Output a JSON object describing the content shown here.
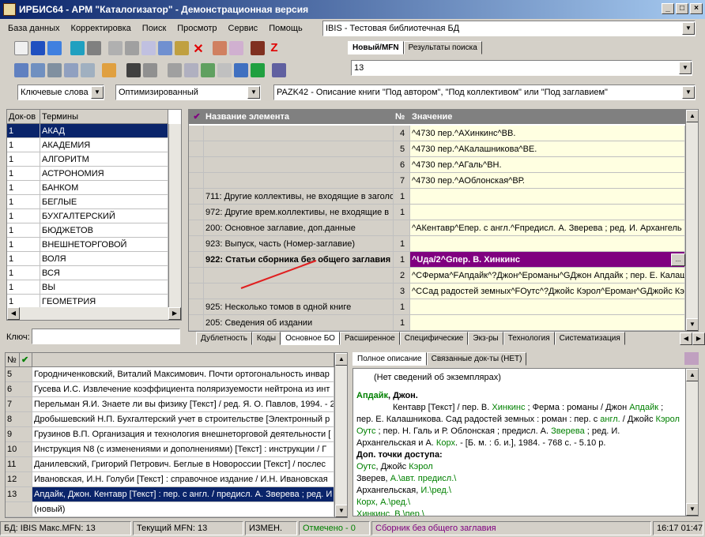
{
  "window": {
    "title": "ИРБИС64 - АРМ \"Каталогизатор\" - Демонстрационная версия"
  },
  "menu": [
    "База данных",
    "Корректировка",
    "Поиск",
    "Просмотр",
    "Сервис",
    "Помощь"
  ],
  "db_select": "IBIS - Тестовая библиотечная БД",
  "mfn_tabs": [
    "Новый/MFN",
    "Результаты поиска"
  ],
  "mfn_value": "13",
  "search_mode": "Ключевые слова",
  "search_opt": "Оптимизированный",
  "worksheet": "PAZK42 - Описание книги \"Под автором\", \"Под коллективом\" или \"Под заглавием\"",
  "terms": {
    "col_docs": "Док-ов",
    "col_terms": "Термины",
    "rows": [
      [
        "1",
        "АКАД"
      ],
      [
        "1",
        "АКАДЕМИЯ"
      ],
      [
        "1",
        "АЛГОРИТМ"
      ],
      [
        "1",
        "АСТРОНОМИЯ"
      ],
      [
        "1",
        "БАНКОМ"
      ],
      [
        "1",
        "БЕГЛЫЕ"
      ],
      [
        "1",
        "БУХГАЛТЕРСКИЙ"
      ],
      [
        "1",
        "БЮДЖЕТОВ"
      ],
      [
        "1",
        "ВНЕШНЕТОРГОВОЙ"
      ],
      [
        "1",
        "ВОЛЯ"
      ],
      [
        "1",
        "ВСЯ"
      ],
      [
        "1",
        "ВЫ"
      ],
      [
        "1",
        "ГЕОМЕТРИЯ"
      ]
    ],
    "key_label": "Ключ:"
  },
  "editor": {
    "col_name": "Название элемента",
    "col_num": "№",
    "col_value": "Значение",
    "rows": [
      [
        "",
        "4",
        "^4730 пер.^AХинкинс^BВ."
      ],
      [
        "",
        "5",
        "^4730 пер.^AКалашникова^BЕ."
      ],
      [
        "",
        "6",
        "^4730 пер.^AГаль^BН."
      ],
      [
        "",
        "7",
        "^4730 пер.^AОблонская^BР."
      ],
      [
        "711: Другие коллективы, не входящие в заголо",
        "1",
        ""
      ],
      [
        "972: Другие врем.коллективы, не входящие в",
        "1",
        ""
      ],
      [
        "200: Основное заглавие, доп.данные",
        "",
        "^AКентавр^Eпер. с англ.^Fпредисл. А. Зверева ; ред. И. Архангель"
      ],
      [
        "923: Выпуск, часть (Номер-заглавие)",
        "1",
        ""
      ],
      [
        "922: Статьи сборника без общего заглавия",
        "1",
        "^Uда/2^Gпер. В. Хинкинс"
      ],
      [
        "",
        "2",
        "^CФерма^FАпдайк^?Джон^Eроманы^GДжон Апдайк ; пер. Е. Калаш"
      ],
      [
        "",
        "3",
        "^CСад радостей земных^FОутс^?Джойс Кэрол^Eроман^GДжойс Кэ"
      ],
      [
        "925: Несколько томов в одной книге",
        "1",
        ""
      ],
      [
        "205: Сведения об издании",
        "1",
        ""
      ]
    ]
  },
  "editor_tabs": [
    "Дублетность",
    "Коды",
    "Основное БО",
    "Расширенное",
    "Специфические",
    "Экз-ры",
    "Технология",
    "Систематизация"
  ],
  "records": {
    "col_num": "№",
    "rows": [
      [
        "5",
        "Городниченковский, Виталий Максимович. Почти ортогональность инвар"
      ],
      [
        "6",
        "Гусева И.С. Извлечение коэффициента поляризуемости нейтрона из инт"
      ],
      [
        "7",
        "Перельман Я.И. Знаете ли вы физику [Текст] / ред. Я. О. Павлов, 1994. - 2"
      ],
      [
        "8",
        "Дробышевский Н.П. Бухгалтерский учет в строительстве [Электронный р"
      ],
      [
        "9",
        "Грузинов В.П. Организация и технология внешнеторговой деятельности ["
      ],
      [
        "10",
        "Инструкция N8  (с изменениями и дополнениями) [Текст] : инструкции / Г"
      ],
      [
        "11",
        "Данилевский, Григорий Петрович. Беглые в Новороссии [Текст] / послес"
      ],
      [
        "12",
        "Ивановская, И.Н. Голуби [Текст] : справочное издание / И.Н. Ивановская"
      ],
      [
        "13",
        "Апдайк, Джон. Кентавр [Текст] : пер. с англ. / предисл. А. Зверева ; ред. И"
      ],
      [
        "",
        "(новый)"
      ]
    ]
  },
  "desc_tabs": [
    "Полное описание",
    "Связанные док-ты (НЕТ)"
  ],
  "desc": {
    "no_copies": "(Нет сведений об экземплярах)",
    "author": "Апдайк",
    "author_rest": ", Джон.",
    "body1": "Кентавр [Текст] / пер. В. ",
    "b_hink": "Хинкинс",
    "body2": " ; Ферма : романы / Джон ",
    "b_apd": "Апдайк",
    "body3": " ; пер. Е. Калашникова. Сад радостей земных : роман : пер. с ",
    "b_engl": "англ.",
    "body4": " / Джойс ",
    "b_kerol": "Кэрол",
    "b_outs": "Оутс",
    "body5": " ; пер. Н. Галь и Р. Облонская ; предисл. А. ",
    "b_zver": "Зверева",
    "body6": " ; ред. И.",
    "body7": "Архангельская и А. ",
    "b_korh": "Корх",
    "body8": ". - [Б. м. : б. и.], 1984. - 768 с. - 5.10 р.",
    "access": "Доп. точки доступа:",
    "p1a": "Оутс",
    "p1b": ", Джойс ",
    "p1c": "Кэрол",
    "p2a": "Зверев, ",
    "p2b": "А.\\авт. предисл.\\",
    "p3a": "Архангельская, ",
    "p3b": "И.\\ред.\\",
    "p4a": "Корх, ",
    "p4b": "А.\\ред.\\",
    "p5a": "Хинкинс, В.\\пер.\\"
  },
  "status": [
    "БД: IBIS Макс.MFN: 13",
    "Текущий MFN: 13",
    "ИЗМЕН.",
    "Отмечено - 0",
    "Сборник без общего заглавия",
    "16:17  01:47"
  ],
  "colors": {
    "selected": "#0a246a",
    "purple": "#800080",
    "editor_value": "#ffffe1"
  }
}
